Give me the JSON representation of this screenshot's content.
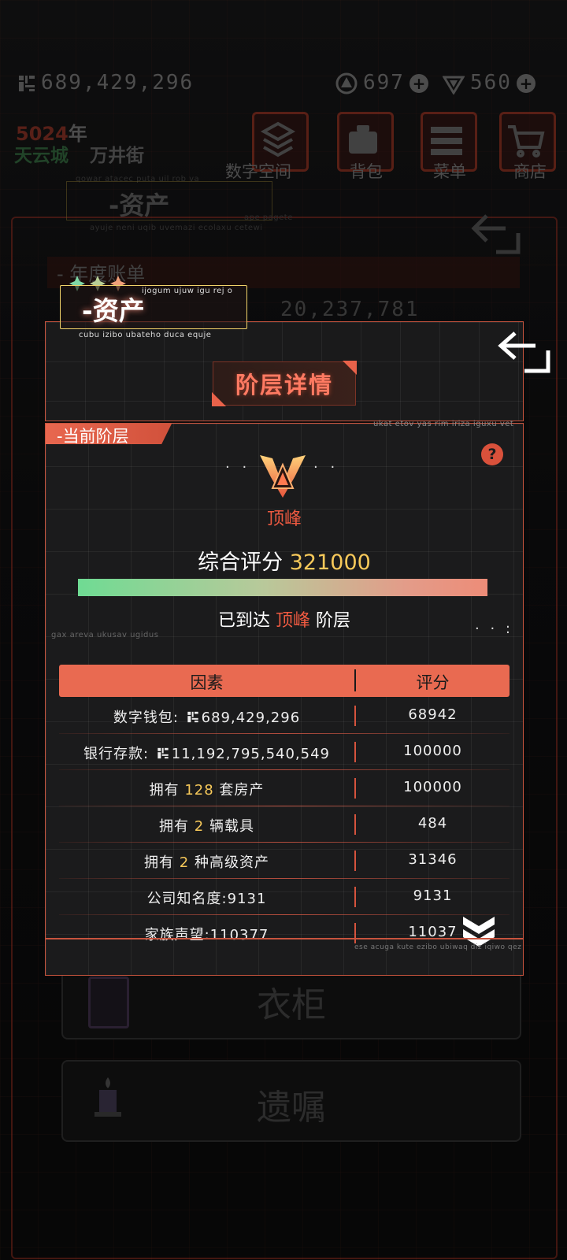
{
  "background": {
    "currency_amount": "689,429,296",
    "gem_a_count": "697",
    "gem_b_count": "560",
    "year_prefix": "5024",
    "year_suffix": "年",
    "location_city": "天云城",
    "location_street": "万井街",
    "nav": [
      "数字空间",
      "背包",
      "菜单",
      "商店"
    ],
    "section_title": "-资产",
    "section_sub": "ayuje neni uqib uvemazi ecolaxu cetewi",
    "section_top_note": "qowar atacec puta uil rob va",
    "annual_bill": "- 年度账单",
    "annual_note": "ape pagete",
    "annual_amount": "20,237,781",
    "panel_wardrobe": "衣柜",
    "panel_will": "遗嘱"
  },
  "asset_tag": {
    "label": "-资产",
    "note_top": "ijogum ujuw igu rej o",
    "note_bottom": "cubu izibo ubateho duca equje"
  },
  "modal": {
    "title": "阶层详情",
    "section_label": "-当前阶层",
    "corner_note": "ukat etov yas rim iriza iguxu vet",
    "help_glyph": "?",
    "rank_name": "顶峰",
    "score_label": "综合评分",
    "score_value": "321000",
    "score_progress": 1.0,
    "reached_prefix": "已到达",
    "reached_rank": "顶峰",
    "reached_suffix": "阶层",
    "left_note": "gax areva ukusav ugidus",
    "footer_note": "ese acuga kute ezibo ubiwaq diz iqiwo qez",
    "table": {
      "col_factor": "因素",
      "col_score": "评分",
      "rows": [
        {
          "pre": "数字钱包: ",
          "coin": true,
          "hl": "",
          "post": "689,429,296",
          "score": "68942"
        },
        {
          "pre": "银行存款: ",
          "coin": true,
          "hl": "",
          "post": "11,192,795,540,549",
          "score": "100000"
        },
        {
          "pre": "拥有 ",
          "coin": false,
          "hl": "128",
          "post": " 套房产",
          "score": "100000"
        },
        {
          "pre": "拥有 ",
          "coin": false,
          "hl": "2",
          "post": " 辆载具",
          "score": "484"
        },
        {
          "pre": "拥有 ",
          "coin": false,
          "hl": "2",
          "post": " 种高级资产",
          "score": "31346"
        },
        {
          "pre": "公司知名度:9131",
          "coin": false,
          "hl": "",
          "post": "",
          "score": "9131"
        },
        {
          "pre": "家族声望:110377",
          "coin": false,
          "hl": "",
          "post": "",
          "score": "11037"
        }
      ]
    }
  },
  "colors": {
    "accent": "#e96a51",
    "rank_red": "#ef5a41",
    "score_yellow": "#f7c95a",
    "border": "#c8543e"
  }
}
